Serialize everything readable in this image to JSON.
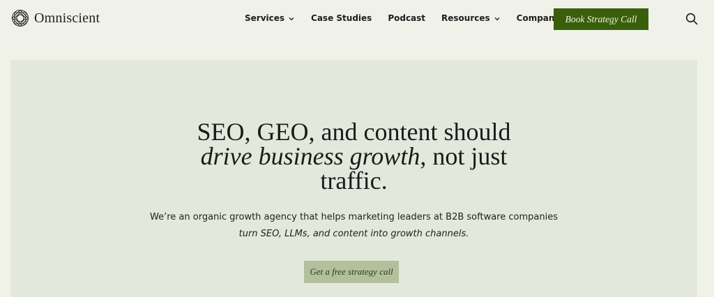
{
  "brand": {
    "name": "Omniscient",
    "logo_icon": "omniscient-knot-logo"
  },
  "nav": {
    "items": [
      {
        "label": "Services",
        "has_dropdown": true
      },
      {
        "label": "Case Studies",
        "has_dropdown": false
      },
      {
        "label": "Podcast",
        "has_dropdown": false
      },
      {
        "label": "Resources",
        "has_dropdown": true
      },
      {
        "label": "Company",
        "has_dropdown": true
      }
    ],
    "cta_label": "Book Strategy Call",
    "search_icon": "search-icon"
  },
  "hero": {
    "title_line1": "SEO, GEO, and content should",
    "title_em": "drive business growth",
    "title_rest": ", not just",
    "title_line3": "traffic.",
    "subtitle": "We’re an organic growth agency that helps marketing leaders at B2B software companies",
    "subtitle_italic": "turn SEO, LLMs, and content into growth channels.",
    "button_label": "Get a free strategy call"
  },
  "colors": {
    "page_bg": "#f0f2ea",
    "hero_bg": "#e3e8dc",
    "cta_bg": "#3a5f0b",
    "hero_button_bg": "#b3c09c"
  }
}
